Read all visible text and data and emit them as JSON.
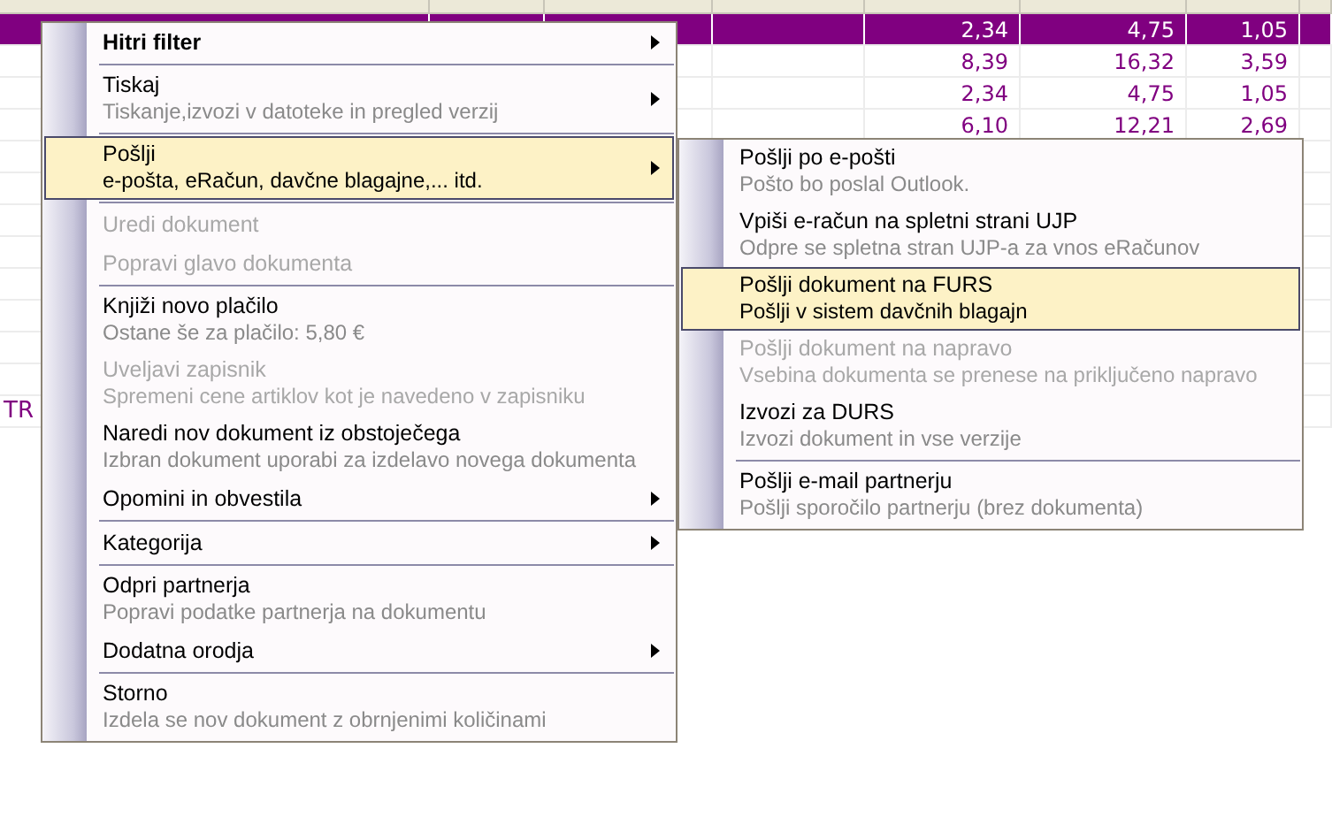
{
  "table": {
    "rows": [
      {
        "selected": true,
        "values": [
          "2,34",
          "4,75",
          "1,05"
        ]
      },
      {
        "selected": false,
        "values": [
          "8,39",
          "16,32",
          "3,59"
        ]
      },
      {
        "selected": false,
        "values": [
          "2,34",
          "4,75",
          "1,05"
        ]
      },
      {
        "selected": false,
        "values": [
          "6,10",
          "12,21",
          "2,69"
        ]
      }
    ],
    "cut_text": "TR"
  },
  "context_menu": {
    "items": [
      {
        "kind": "item",
        "label": "Hitri filter",
        "default": true,
        "submenu": true,
        "disabled": false,
        "selected": false
      },
      {
        "kind": "separator"
      },
      {
        "kind": "item",
        "label": "Tiskaj",
        "sublabel": "Tiskanje,izvozi v datoteke in pregled verzij",
        "submenu": true,
        "disabled": false,
        "selected": false
      },
      {
        "kind": "separator"
      },
      {
        "kind": "item",
        "label": "Pošlji",
        "sublabel": "e-pošta, eRačun, davčne blagajne,... itd.",
        "submenu": true,
        "disabled": false,
        "selected": true
      },
      {
        "kind": "separator"
      },
      {
        "kind": "item",
        "label": "Uredi dokument",
        "submenu": false,
        "disabled": true,
        "selected": false
      },
      {
        "kind": "item",
        "label": "Popravi glavo dokumenta",
        "submenu": false,
        "disabled": true,
        "selected": false
      },
      {
        "kind": "separator"
      },
      {
        "kind": "item",
        "label": "Knjiži novo plačilo",
        "sublabel": "Ostane še za plačilo: 5,80 €",
        "submenu": false,
        "disabled": false,
        "selected": false
      },
      {
        "kind": "item",
        "label": "Uveljavi zapisnik",
        "sublabel": "Spremeni cene artiklov kot je navedeno v zapisniku",
        "submenu": false,
        "disabled": true,
        "selected": false
      },
      {
        "kind": "item",
        "label": "Naredi nov dokument iz obstoječega",
        "sublabel": "Izbran dokument uporabi za izdelavo novega dokumenta",
        "submenu": false,
        "disabled": false,
        "selected": false
      },
      {
        "kind": "item",
        "label": "Opomini in obvestila",
        "submenu": true,
        "disabled": false,
        "selected": false
      },
      {
        "kind": "separator"
      },
      {
        "kind": "item",
        "label": "Kategorija",
        "submenu": true,
        "disabled": false,
        "selected": false
      },
      {
        "kind": "separator"
      },
      {
        "kind": "item",
        "label": "Odpri partnerja",
        "sublabel": "Popravi podatke partnerja na dokumentu",
        "submenu": false,
        "disabled": false,
        "selected": false
      },
      {
        "kind": "item",
        "label": "Dodatna orodja",
        "submenu": true,
        "disabled": false,
        "selected": false
      },
      {
        "kind": "separator"
      },
      {
        "kind": "item",
        "label": "Storno",
        "sublabel": "Izdela se nov dokument z obrnjenimi količinami",
        "submenu": false,
        "disabled": false,
        "selected": false
      }
    ]
  },
  "submenu": {
    "items": [
      {
        "kind": "item",
        "label": "Pošlji po e-pošti",
        "sublabel": "Pošto bo poslal Outlook.",
        "submenu": false,
        "disabled": false,
        "selected": false
      },
      {
        "kind": "item",
        "label": "Vpiši e-račun na spletni strani UJP",
        "sublabel": "Odpre se spletna stran UJP-a za vnos eRačunov",
        "submenu": false,
        "disabled": false,
        "selected": false
      },
      {
        "kind": "item",
        "label": "Pošlji dokument na FURS",
        "sublabel": "Pošlji v sistem davčnih blagajn",
        "submenu": false,
        "disabled": false,
        "selected": true
      },
      {
        "kind": "item",
        "label": "Pošlji dokument na napravo",
        "sublabel": "Vsebina dokumenta se prenese na priključeno napravo",
        "submenu": false,
        "disabled": true,
        "selected": false
      },
      {
        "kind": "item",
        "label": "Izvozi za DURS",
        "sublabel": "Izvozi dokument in vse verzije",
        "submenu": false,
        "disabled": false,
        "selected": false
      },
      {
        "kind": "separator"
      },
      {
        "kind": "item",
        "label": "Pošlji e-mail partnerju",
        "sublabel": "Pošlji sporočilo partnerju (brez dokumenta)",
        "submenu": false,
        "disabled": false,
        "selected": false
      }
    ]
  }
}
